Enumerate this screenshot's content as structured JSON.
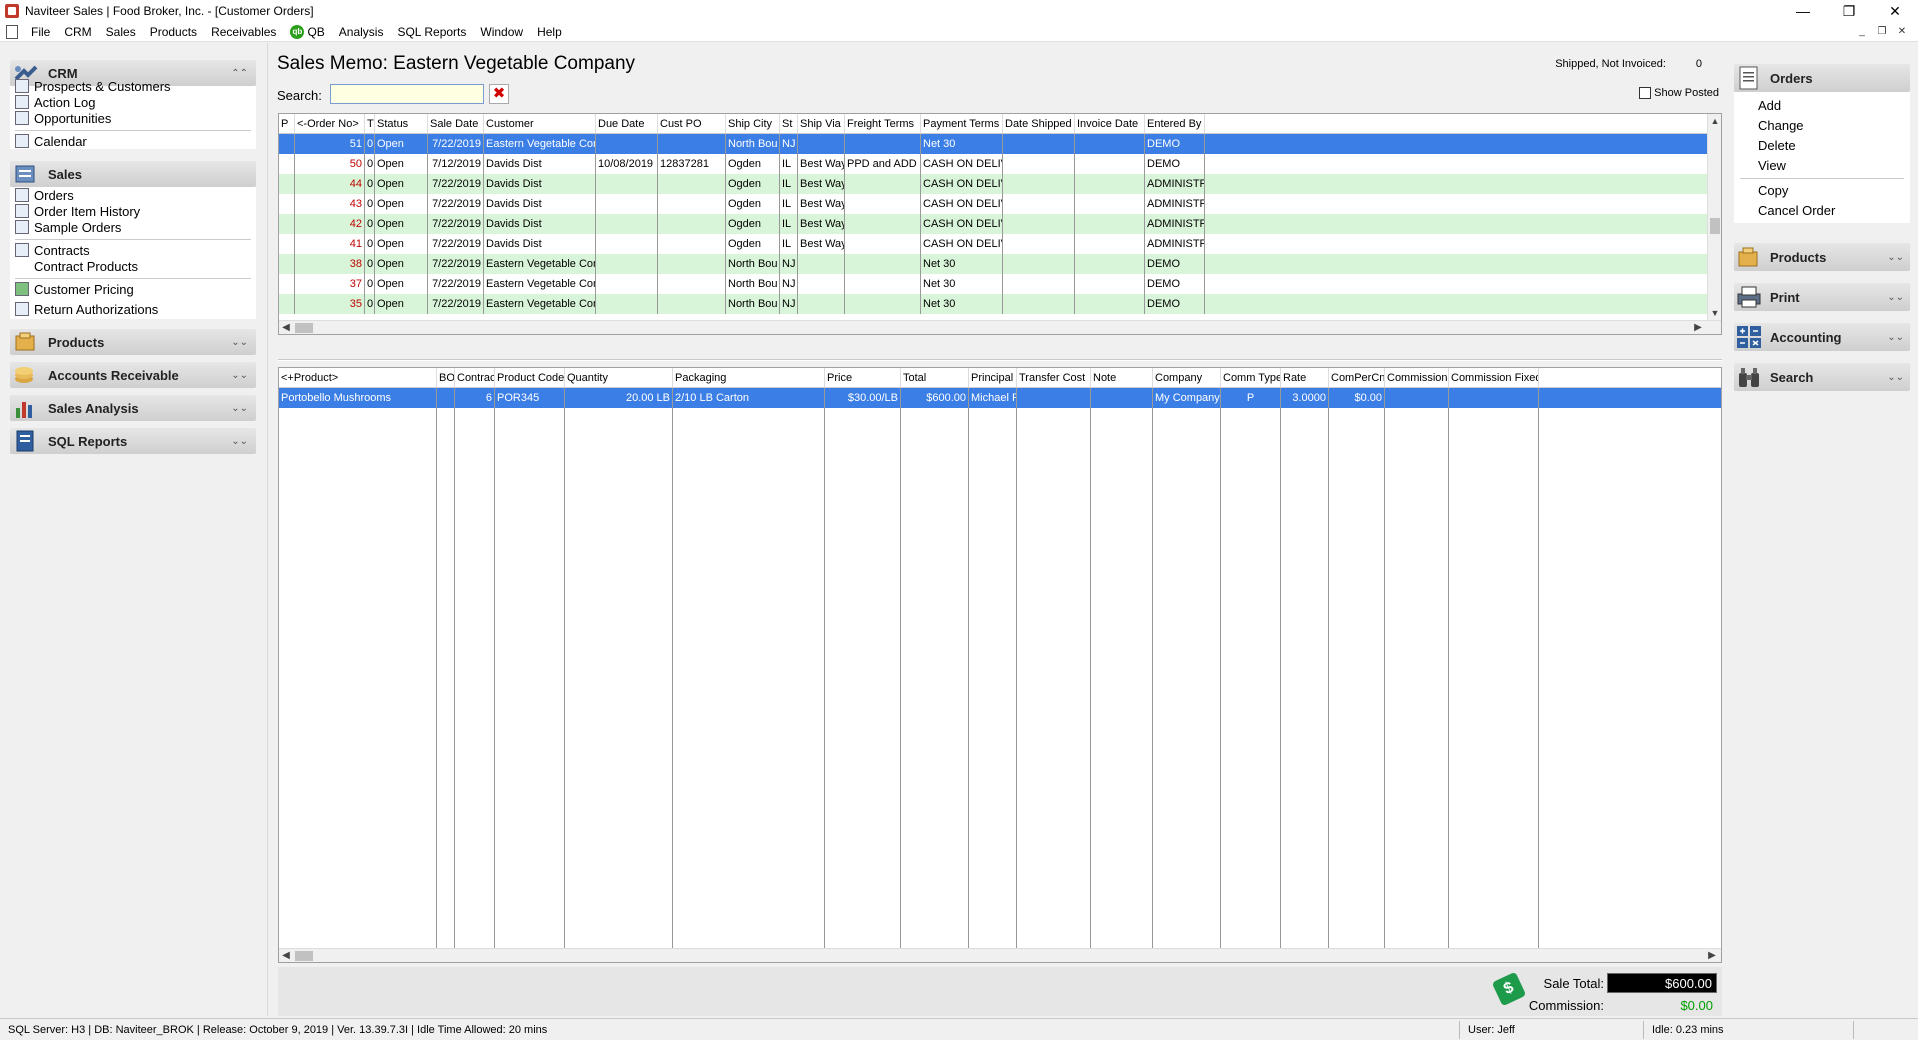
{
  "window": {
    "title": "Naviteer Sales | Food Broker, Inc. - [Customer Orders]",
    "minimize": "—",
    "restore": "❐",
    "close": "✕"
  },
  "menu": {
    "items": [
      "File",
      "CRM",
      "Sales",
      "Products",
      "Receivables"
    ],
    "qb_badge": "qb",
    "qb": "QB",
    "items2": [
      "Analysis",
      "SQL Reports",
      "Window",
      "Help"
    ],
    "mdi": [
      "_",
      "❐",
      "✕"
    ]
  },
  "sidebar": {
    "crm": {
      "label": "CRM",
      "chevron": "⌃⌃",
      "items": [
        "Prospects & Customers",
        "Action Log",
        "Opportunities",
        "Calendar"
      ]
    },
    "sales": {
      "label": "Sales",
      "items": [
        "Orders",
        "Order Item History",
        "Sample Orders",
        "Contracts",
        "Contract Products",
        "Customer Pricing",
        "Return Authorizations"
      ]
    },
    "collapsed": [
      {
        "label": "Products",
        "chevron": "⌄⌄"
      },
      {
        "label": "Accounts Receivable",
        "chevron": "⌄⌄"
      },
      {
        "label": "Sales Analysis",
        "chevron": "⌄⌄"
      },
      {
        "label": "SQL Reports",
        "chevron": "⌄⌄"
      }
    ]
  },
  "main": {
    "title": "Sales Memo: Eastern Vegetable Company",
    "shipped_label": "Shipped, Not Invoiced:",
    "shipped_value": "0",
    "search_label": "Search:",
    "search_value": "",
    "search_clear": "✖",
    "show_posted": "Show Posted"
  },
  "orders_grid": {
    "columns": [
      "P",
      "<-Order No>",
      "T",
      "Status",
      "Sale Date",
      "Customer",
      "Due Date",
      "Cust PO",
      "Ship City",
      "St",
      "Ship Via",
      "Freight Terms",
      "Payment Terms",
      "Date Shipped",
      "Invoice Date",
      "Entered By"
    ],
    "rows": [
      {
        "p": "",
        "order": "51",
        "t": "0",
        "status": "Open",
        "sale_date": "7/22/2019",
        "customer": "Eastern Vegetable Con",
        "due": "",
        "po": "",
        "city": "North Bou",
        "st": "NJ",
        "via": "",
        "freight": "",
        "payment": "Net 30",
        "shipped": "",
        "invoice": "",
        "entered": "DEMO",
        "style": "sel"
      },
      {
        "p": "",
        "order": "50",
        "t": "0",
        "status": "Open",
        "sale_date": "7/12/2019",
        "customer": "Davids Dist",
        "due": "10/08/2019",
        "po": "12837281",
        "city": "Ogden",
        "st": "IL",
        "via": "Best Way",
        "freight": "PPD and ADD",
        "payment": "CASH ON DELIV",
        "shipped": "",
        "invoice": "",
        "entered": "DEMO",
        "style": "white"
      },
      {
        "p": "",
        "order": "44",
        "t": "0",
        "status": "Open",
        "sale_date": "7/22/2019",
        "customer": "Davids Dist",
        "due": "",
        "po": "",
        "city": "Ogden",
        "st": "IL",
        "via": "Best Way",
        "freight": "",
        "payment": "CASH ON DELIV",
        "shipped": "",
        "invoice": "",
        "entered": "ADMINISTF",
        "style": "green"
      },
      {
        "p": "",
        "order": "43",
        "t": "0",
        "status": "Open",
        "sale_date": "7/22/2019",
        "customer": "Davids Dist",
        "due": "",
        "po": "",
        "city": "Ogden",
        "st": "IL",
        "via": "Best Way",
        "freight": "",
        "payment": "CASH ON DELIV",
        "shipped": "",
        "invoice": "",
        "entered": "ADMINISTF",
        "style": "white"
      },
      {
        "p": "",
        "order": "42",
        "t": "0",
        "status": "Open",
        "sale_date": "7/22/2019",
        "customer": "Davids Dist",
        "due": "",
        "po": "",
        "city": "Ogden",
        "st": "IL",
        "via": "Best Way",
        "freight": "",
        "payment": "CASH ON DELIV",
        "shipped": "",
        "invoice": "",
        "entered": "ADMINISTF",
        "style": "green"
      },
      {
        "p": "",
        "order": "41",
        "t": "0",
        "status": "Open",
        "sale_date": "7/22/2019",
        "customer": "Davids Dist",
        "due": "",
        "po": "",
        "city": "Ogden",
        "st": "IL",
        "via": "Best Way",
        "freight": "",
        "payment": "CASH ON DELIV",
        "shipped": "",
        "invoice": "",
        "entered": "ADMINISTF",
        "style": "white"
      },
      {
        "p": "",
        "order": "38",
        "t": "0",
        "status": "Open",
        "sale_date": "7/22/2019",
        "customer": "Eastern Vegetable Con",
        "due": "",
        "po": "",
        "city": "North Bou",
        "st": "NJ",
        "via": "",
        "freight": "",
        "payment": "Net 30",
        "shipped": "",
        "invoice": "",
        "entered": "DEMO",
        "style": "green"
      },
      {
        "p": "",
        "order": "37",
        "t": "0",
        "status": "Open",
        "sale_date": "7/22/2019",
        "customer": "Eastern Vegetable Con",
        "due": "",
        "po": "",
        "city": "North Bou",
        "st": "NJ",
        "via": "",
        "freight": "",
        "payment": "Net 30",
        "shipped": "",
        "invoice": "",
        "entered": "DEMO",
        "style": "white"
      },
      {
        "p": "",
        "order": "35",
        "t": "0",
        "status": "Open",
        "sale_date": "7/22/2019",
        "customer": "Eastern Vegetable Con",
        "due": "",
        "po": "",
        "city": "North Bou",
        "st": "NJ",
        "via": "",
        "freight": "",
        "payment": "Net 30",
        "shipped": "",
        "invoice": "",
        "entered": "DEMO",
        "style": "green"
      }
    ]
  },
  "items_grid": {
    "columns": [
      "<+Product>",
      "BO",
      "Contract",
      "Product Code",
      "Quantity",
      "Packaging",
      "Price",
      "Total",
      "Principal",
      "Transfer Cost",
      "Note",
      "Company",
      "Comm Type",
      "Rate",
      "ComPerCnt",
      "Commission",
      "Commission Fixed"
    ],
    "rows": [
      {
        "product": "Portobello Mushrooms",
        "bo": "",
        "contract": "6",
        "code": "POR345",
        "quantity": "20.00 LB",
        "packaging": "2/10  LB Carton",
        "price": "$30.00/LB",
        "total": "$600.00",
        "principal": "Michael F",
        "transfer": "",
        "note": "",
        "company": "My Company",
        "comm_type": "P",
        "rate": "3.0000",
        "compercnt": "$0.00",
        "commission": "",
        "comm_fixed": ""
      }
    ]
  },
  "totals": {
    "sale_total_label": "Sale Total:",
    "sale_total": "$600.00",
    "commission_label": "Commission:",
    "commission": "$0.00"
  },
  "right_panel": {
    "orders": {
      "label": "Orders",
      "items": [
        "Add",
        "Change",
        "Delete",
        "View",
        "Copy",
        "Cancel Order"
      ]
    },
    "collapsed": [
      {
        "label": "Products",
        "chevron": "⌄⌄"
      },
      {
        "label": "Print",
        "chevron": "⌄⌄"
      },
      {
        "label": "Accounting",
        "chevron": "⌄⌄"
      },
      {
        "label": "Search",
        "chevron": "⌄⌄"
      }
    ]
  },
  "status": {
    "server": "SQL Server: H3 | DB: Naviteer_BROK | Release: October 9, 2019 | Ver. 13.39.7.3I | Idle Time Allowed: 20 mins",
    "user": "User: Jeff",
    "idle": "Idle: 0.23 mins"
  },
  "colors": {
    "selected_row": "#3b7ee6",
    "green_row": "#d9f5d9",
    "order_no_red": "#c00000",
    "commission_green": "#00a000"
  }
}
